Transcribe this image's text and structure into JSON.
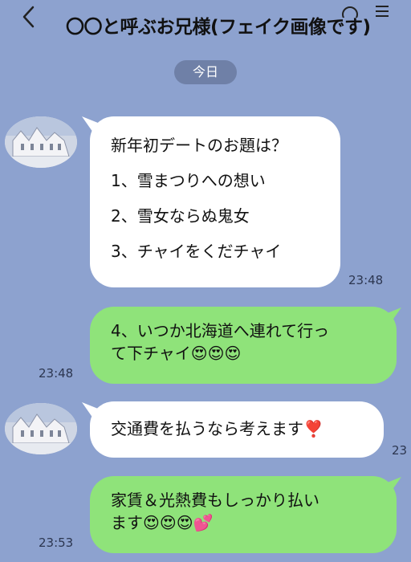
{
  "header": {
    "title": "〇〇と呼ぶお兄様(フェイク画像です)",
    "back_icon": "chevron-left-icon"
  },
  "date_label": "今日",
  "messages": [
    {
      "side": "in",
      "lines": [
        "新年初デートのお題は？",
        "1、雪まつりへの想い",
        "2、雪女ならぬ鬼女",
        "3、チャイをくだチャイ"
      ],
      "time": "23:48"
    },
    {
      "side": "out",
      "lines": [
        "4、いつか北海道へ連れて行っ",
        "て下チャイ😍😍😍"
      ],
      "time": "23:48"
    },
    {
      "side": "in",
      "lines": [
        "交通費を払うなら考えます❣️"
      ],
      "time": "23"
    },
    {
      "side": "out",
      "lines": [
        "家賃＆光熱費もしっかり払い",
        "ます😍😍😍💕"
      ],
      "time": "23:53"
    }
  ],
  "colors": {
    "background": "#8da2cf",
    "incoming_bubble": "#ffffff",
    "outgoing_bubble": "#8fe37a",
    "date_pill": "#6f80a7"
  }
}
